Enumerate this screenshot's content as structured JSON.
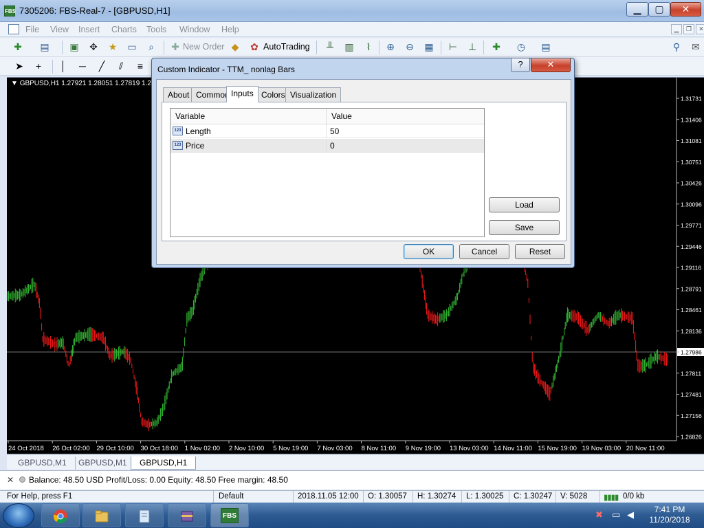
{
  "window": {
    "title": "7305206: FBS-Real-7 - [GBPUSD,H1]",
    "app_icon_text": "FBS",
    "minimize": "▁",
    "maximize": "▢",
    "close": "✕"
  },
  "menu": {
    "items": [
      "File",
      "View",
      "Insert",
      "Charts",
      "Tools",
      "Window",
      "Help"
    ]
  },
  "toolbar": {
    "new_order": "New Order",
    "autotrading": "AutoTrading"
  },
  "chart": {
    "header": "GBPUSD,H1  1.27921 1.28051 1.27819 1.279",
    "price_labels": [
      "1.31731",
      "1.31406",
      "1.31081",
      "1.30751",
      "1.30426",
      "1.30096",
      "1.29771",
      "1.29446",
      "1.29116",
      "1.28791",
      "1.28461",
      "1.28136",
      "1.27986",
      "1.27811",
      "1.27481",
      "1.27156",
      "1.26826"
    ],
    "current_price": "1.27986",
    "time_labels": [
      "24 Oct 2018",
      "26 Oct 02:00",
      "29 Oct 10:00",
      "30 Oct 18:00",
      "1 Nov 02:00",
      "2 Nov 10:00",
      "5 Nov 19:00",
      "7 Nov 03:00",
      "8 Nov 11:00",
      "9 Nov 19:00",
      "13 Nov 03:00",
      "14 Nov 11:00",
      "15 Nov 19:00",
      "19 Nov 03:00",
      "20 Nov 11:00"
    ],
    "colors": {
      "background": "#000000",
      "up": "#36c236",
      "down": "#ff1a1a",
      "axis_text": "#ffffff"
    }
  },
  "chart_tabs": [
    "GBPUSD,M1",
    "GBPUSD,M1",
    "GBPUSD,H1"
  ],
  "terminal": {
    "balance_line": "Balance: 48.50 USD  Profit/Loss: 0.00  Equity: 48.50  Free margin: 48.50"
  },
  "statusbar": {
    "help": "For Help, press F1",
    "profile": "Default",
    "datetime": "2018.11.05 12:00",
    "open": "O: 1.30057",
    "high": "H: 1.30274",
    "low": "L: 1.30025",
    "close": "C: 1.30247",
    "volume": "V: 5028",
    "traffic": "0/0 kb"
  },
  "taskbar": {
    "time": "7:41 PM",
    "date": "11/20/2018",
    "fbs_label": "FBS"
  },
  "dialog": {
    "title": "Custom Indicator - TTM_ nonlag Bars",
    "help": "?",
    "close": "✕",
    "tabs": [
      "About",
      "Common",
      "Inputs",
      "Colors",
      "Visualization"
    ],
    "active_tab": "Inputs",
    "columns": [
      "Variable",
      "Value"
    ],
    "rows": [
      {
        "variable": "Length",
        "value": "50",
        "icon": "123"
      },
      {
        "variable": "Price",
        "value": "0",
        "icon": "123"
      }
    ],
    "buttons": {
      "load": "Load",
      "save": "Save",
      "ok": "OK",
      "cancel": "Cancel",
      "reset": "Reset"
    }
  }
}
